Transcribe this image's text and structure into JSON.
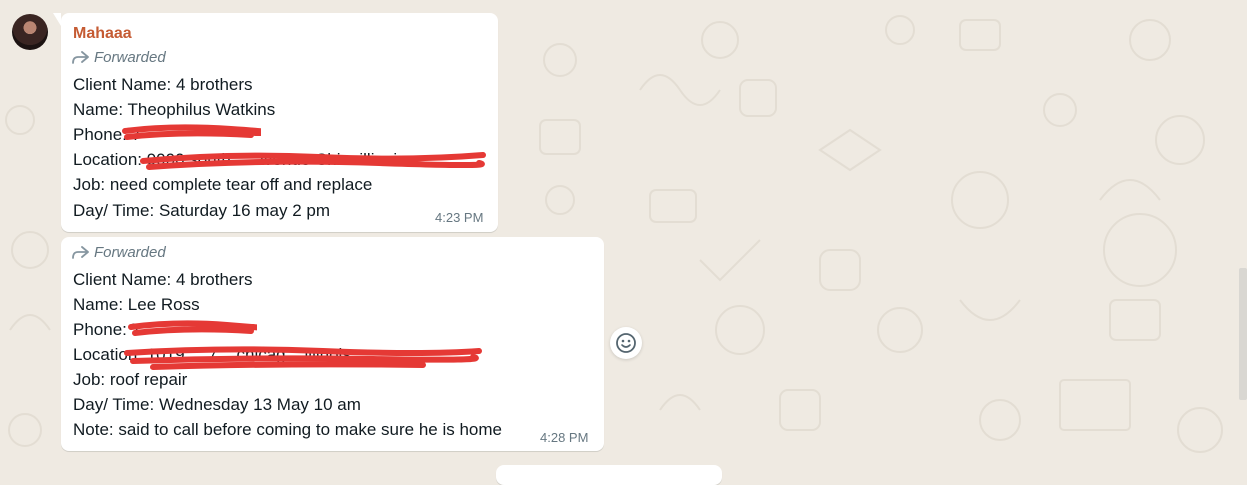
{
  "colors": {
    "chat_bg": "#efeae2",
    "bubble": "#ffffff",
    "sender": "#c55b33",
    "meta": "#667781",
    "redaction": "#e53935"
  },
  "message1": {
    "sender": "Mahaaa",
    "forwarded_label": "Forwarded",
    "lines": {
      "client": "Client Name: 4 brothers",
      "name": "Name: Theophilus Watkins",
      "phone": "Phone: 7",
      "location": "Location: 9000 south ... avenue Chi... illinois",
      "job": "Job:  need complete tear off and replace",
      "daytime": "Day/ Time: Saturday 16 may 2 pm"
    },
    "time": "4:23 PM"
  },
  "message2": {
    "forwarded_label": "Forwarded",
    "lines": {
      "client": "Client Name: 4 brothers",
      "name": "Name: Lee Ross",
      "phone": "Phone: 7",
      "location": "Location: 1019 ... 7... chicag... illinois",
      "job": "Job: roof repair",
      "daytime": "Day/ Time: Wednesday 13 May 10 am",
      "note": "Note: said to call before coming to make sure he is home"
    },
    "time": "4:28 PM"
  },
  "icons": {
    "forward": "forward-arrow-icon",
    "reaction": "smiley-icon"
  }
}
